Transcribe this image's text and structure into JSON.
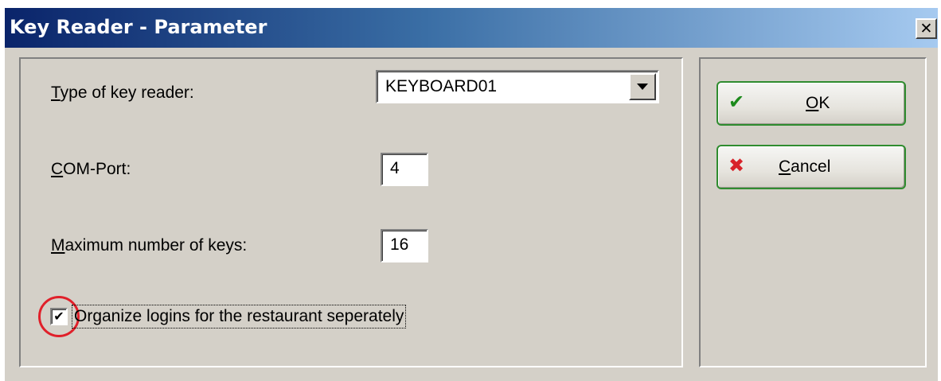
{
  "window": {
    "title": "Key Reader - Parameter",
    "close_glyph": "✕"
  },
  "form": {
    "reader_type": {
      "label_hotkey": "T",
      "label_rest": "ype of key reader:",
      "value": "KEYBOARD01"
    },
    "com_port": {
      "label_hotkey": "C",
      "label_rest": "OM-Port:",
      "value": "4"
    },
    "max_keys": {
      "label_hotkey": "M",
      "label_rest": "aximum number of keys:",
      "value": "16"
    },
    "organize_logins": {
      "label": "Organize logins for the restaurant seperately",
      "checked": true,
      "check_glyph": "✔"
    }
  },
  "buttons": {
    "ok": {
      "label_hotkey": "O",
      "label_rest": "K",
      "icon": "checkmark-icon",
      "icon_glyph": "✔",
      "icon_color": "#1c8a1c"
    },
    "cancel": {
      "label_hotkey": "C",
      "label_rest": "ancel",
      "icon": "red-x-icon",
      "icon_glyph": "✖",
      "icon_color": "#d8232a"
    }
  },
  "colors": {
    "titlebar_start": "#0a246a",
    "titlebar_end": "#a6caf0",
    "dialog_bg": "#d4d0c8",
    "highlight_ring": "#e0202a",
    "button_border": "#2f8c2f"
  }
}
